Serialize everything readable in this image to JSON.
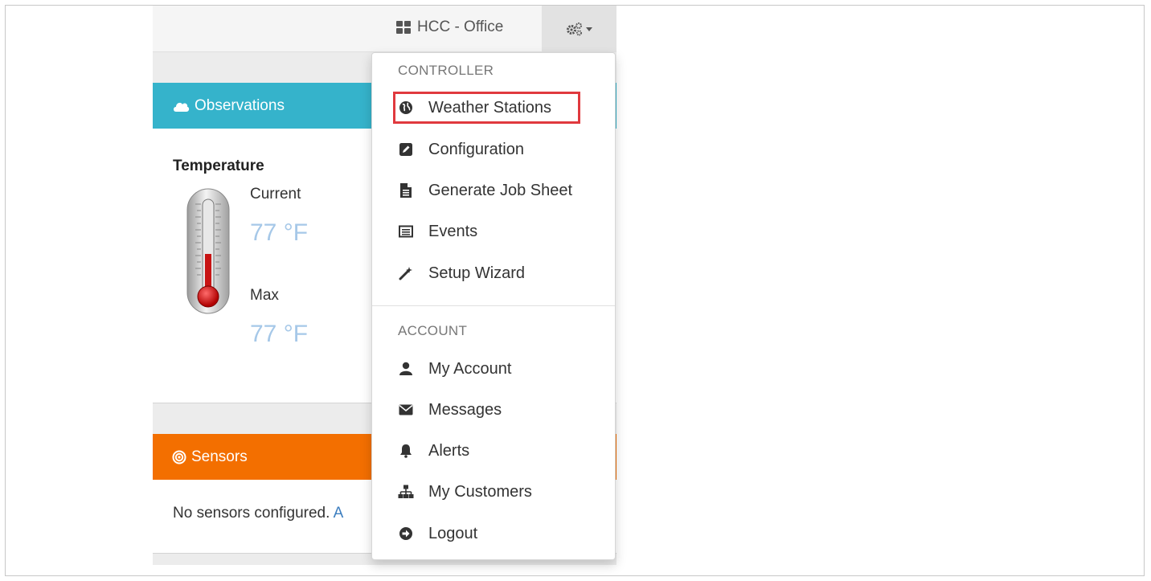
{
  "navbar": {
    "location_label": "HCC - Office",
    "location_icon": "grid-icon",
    "settings_icon": "gears-icon"
  },
  "observations": {
    "title": "Observations",
    "temperature": {
      "heading": "Temperature",
      "current_label": "Current",
      "current_value": "77 °F",
      "max_label": "Max",
      "max_value": "77 °F"
    }
  },
  "sensors": {
    "title": "Sensors",
    "empty_text": "No sensors configured.",
    "empty_link": "A"
  },
  "menu": {
    "controller_header": "CONTROLLER",
    "controller_items": [
      {
        "label": "Weather Stations",
        "icon": "globe-icon"
      },
      {
        "label": "Configuration",
        "icon": "edit-icon"
      },
      {
        "label": "Generate Job Sheet",
        "icon": "file-icon"
      },
      {
        "label": "Events",
        "icon": "list-icon"
      },
      {
        "label": "Setup Wizard",
        "icon": "wand-icon"
      }
    ],
    "account_header": "ACCOUNT",
    "account_items": [
      {
        "label": "My Account",
        "icon": "user-icon"
      },
      {
        "label": "Messages",
        "icon": "envelope-icon"
      },
      {
        "label": "Alerts",
        "icon": "bell-icon"
      },
      {
        "label": "My Customers",
        "icon": "sitemap-icon"
      },
      {
        "label": "Logout",
        "icon": "logout-icon"
      }
    ]
  },
  "colors": {
    "observations_header": "#35b3cb",
    "sensors_header": "#f36f00",
    "highlight": "#e0393e",
    "temp_value": "#a6c8e8"
  }
}
